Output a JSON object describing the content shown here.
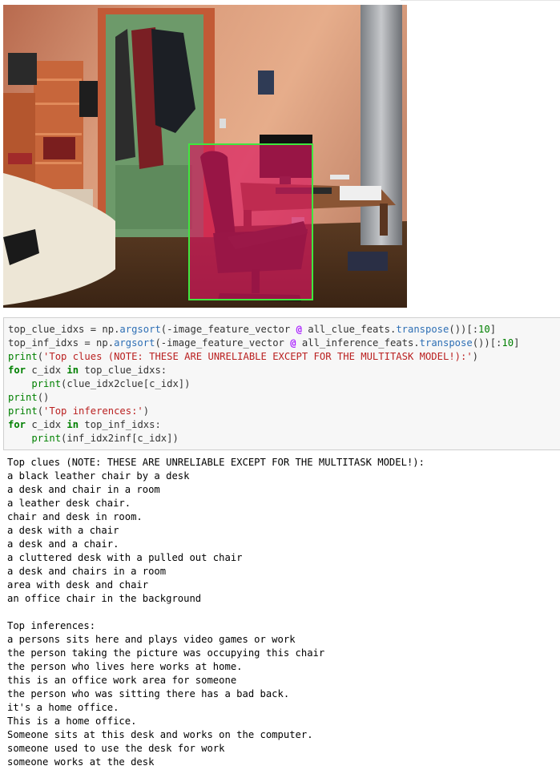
{
  "code_cell": {
    "line1": {
      "a": "top_clue_idxs = np.",
      "b": "argsort",
      "c": "(-image_feature_vector ",
      "d": "@",
      "e": " all_clue_feats.",
      "f": "transpose",
      "g": "())[:",
      "h": "10",
      "i": "]"
    },
    "line2": {
      "a": "top_inf_idxs = np.",
      "b": "argsort",
      "c": "(-image_feature_vector ",
      "d": "@",
      "e": " all_inference_feats.",
      "f": "transpose",
      "g": "())[:",
      "h": "10",
      "i": "]"
    },
    "line3": {
      "fn": "print",
      "open": "(",
      "str": "'Top clues (NOTE: THESE ARE UNRELIABLE EXCEPT FOR THE MULTITASK MODEL!):'",
      "close": ")"
    },
    "line4": {
      "kw_for": "for",
      "a": " c_idx ",
      "kw_in": "in",
      "b": " top_clue_idxs:"
    },
    "line5": {
      "indent": "    ",
      "fn": "print",
      "rest": "(clue_idx2clue[c_idx])"
    },
    "line6": {
      "fn": "print",
      "rest": "()"
    },
    "line7": {
      "fn": "print",
      "open": "(",
      "str": "'Top inferences:'",
      "close": ")"
    },
    "line8": {
      "kw_for": "for",
      "a": " c_idx ",
      "kw_in": "in",
      "b": " top_inf_idxs:"
    },
    "line9": {
      "indent": "    ",
      "fn": "print",
      "rest": "(inf_idx2inf[c_idx])"
    }
  },
  "output": {
    "clues_header": "Top clues (NOTE: THESE ARE UNRELIABLE EXCEPT FOR THE MULTITASK MODEL!):",
    "clues": [
      "a black leather chair by a desk",
      "a desk and chair in a room",
      "a leather desk chair.",
      "chair and desk in room.",
      "a desk with a chair",
      "a desk and a chair.",
      "a cluttered desk with a pulled out chair",
      "a desk and chairs in a room",
      "area with desk and chair",
      "an office chair in the background"
    ],
    "inferences_header": "Top inferences:",
    "inferences": [
      "a persons sits here and plays video games or work",
      "the person taking the picture was occupying this chair",
      "the person who lives here works at home.",
      "this is an office work area for someone",
      "the person who was sitting there has a bad back.",
      "it's a home office.",
      "This is a home office.",
      "Someone sits at this desk and works on the computer.",
      "someone used to use the desk for work",
      "someone works at the desk"
    ]
  },
  "colors": {
    "highlight_fill": "#d9185e",
    "box_outline": "#3ee83e"
  }
}
